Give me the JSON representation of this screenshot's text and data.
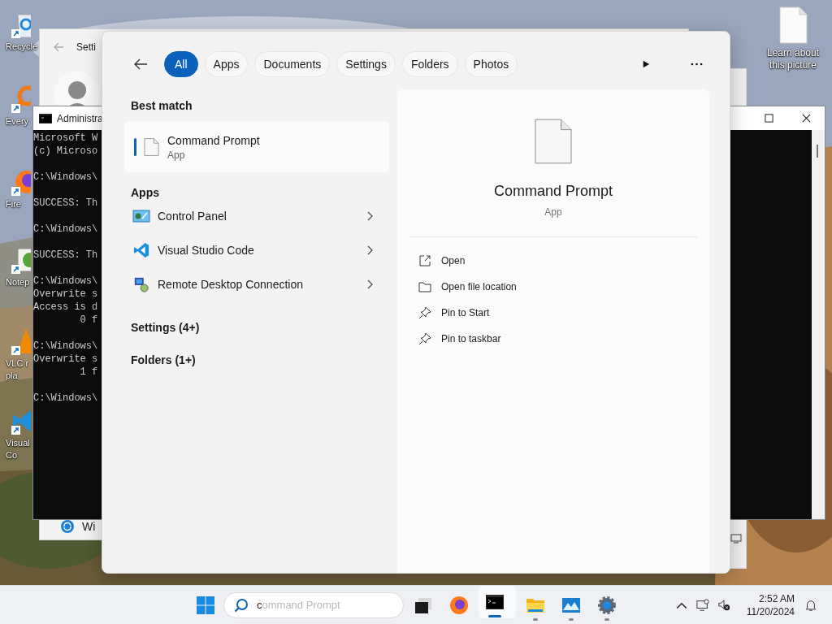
{
  "desktop_icons": [
    {
      "kind": "recycle",
      "label": [
        "Recycle"
      ]
    },
    {
      "kind": "everything",
      "label": [
        "Every"
      ]
    },
    {
      "kind": "firefox",
      "label": [
        "Fire"
      ]
    },
    {
      "kind": "notepad",
      "label": [
        "Notep"
      ]
    },
    {
      "kind": "vlc",
      "label": [
        "VLC r",
        "pla"
      ]
    },
    {
      "kind": "vscode",
      "label": [
        "Visual",
        "Co"
      ]
    }
  ],
  "learn_icon": {
    "label": [
      "Learn about",
      "this picture"
    ]
  },
  "settings_window": {
    "title": "Setti",
    "footer": "Wi"
  },
  "cmd_window": {
    "title": "Administra",
    "blocks": [
      [
        "Microsoft W",
        "(c) Microso"
      ],
      [
        "C:\\Windows\\"
      ],
      [
        "SUCCESS: Th"
      ],
      [
        "C:\\Windows\\"
      ],
      [
        "SUCCESS: Th"
      ],
      [
        "C:\\Windows\\",
        "Overwrite s",
        "Access is d",
        "        0 f"
      ],
      [
        "C:\\Windows\\",
        "Overwrite s",
        "        1 f"
      ],
      [
        "C:\\Windows\\"
      ]
    ]
  },
  "search": {
    "filters": [
      {
        "label": "All",
        "selected": true
      },
      {
        "label": "Apps",
        "selected": false
      },
      {
        "label": "Documents",
        "selected": false
      },
      {
        "label": "Settings",
        "selected": false
      },
      {
        "label": "Folders",
        "selected": false
      },
      {
        "label": "Photos",
        "selected": false
      }
    ],
    "best_match": {
      "heading": "Best match",
      "name": "Command Prompt",
      "type": "App",
      "selected": true
    },
    "apps": {
      "heading": "Apps",
      "items": [
        {
          "kind": "control-panel",
          "name": "Control Panel"
        },
        {
          "kind": "vscode",
          "name": "Visual Studio Code"
        },
        {
          "kind": "remote",
          "name": "Remote Desktop Connection"
        }
      ]
    },
    "groups": [
      "Settings (4+)",
      "Folders (1+)"
    ],
    "preview": {
      "name": "Command Prompt",
      "type": "App",
      "actions": [
        {
          "kind": "open",
          "label": "Open"
        },
        {
          "kind": "folder",
          "label": "Open file location"
        },
        {
          "kind": "pin",
          "label": "Pin to Start"
        },
        {
          "kind": "pin",
          "label": "Pin to taskbar"
        }
      ]
    }
  },
  "taskbar": {
    "search": {
      "value": "c",
      "suggestion": "ommand Prompt"
    },
    "apps": [
      {
        "kind": "taskview",
        "running": false,
        "active": false
      },
      {
        "kind": "firefox",
        "running": false,
        "active": false
      },
      {
        "kind": "terminal",
        "running": true,
        "active": true
      },
      {
        "kind": "folder",
        "running": true,
        "active": false
      },
      {
        "kind": "gallery",
        "running": true,
        "active": false
      },
      {
        "kind": "settings",
        "running": true,
        "active": false
      }
    ],
    "clock": {
      "time": "2:52 AM",
      "date": "11/20/2024"
    }
  }
}
